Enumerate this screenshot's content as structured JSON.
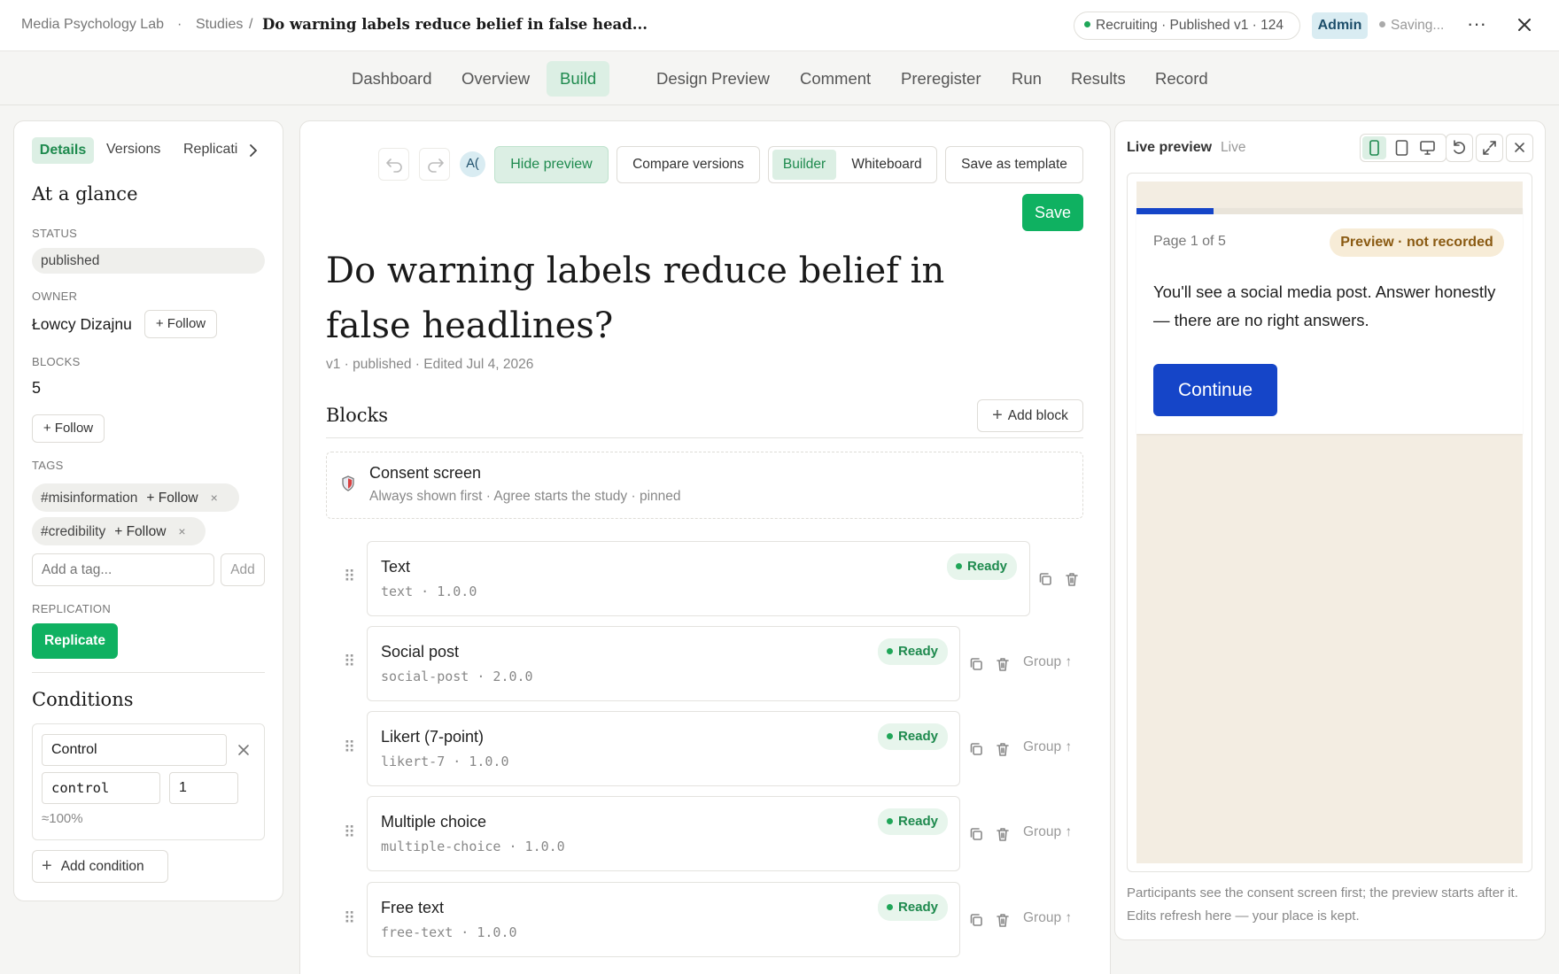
{
  "breadcrumb": {
    "org": "Media Psychology Lab",
    "sep1": "·",
    "studies": "Studies",
    "sep2": "/",
    "current": "Do warning labels reduce belief in false head..."
  },
  "header": {
    "status": "Recruiting · Published v1 · 124",
    "role": "Admin",
    "saving": "Saving...",
    "more_icon": "ellipsis-icon",
    "close_icon": "close-icon"
  },
  "nav_tabs": [
    "Dashboard",
    "Overview",
    "Build",
    "Design",
    "Preview",
    "Comment",
    "Preregister",
    "Run",
    "Results",
    "Record"
  ],
  "active_tab": "Build",
  "sidebar": {
    "tabs": [
      "Details",
      "Versions",
      "Replicati"
    ],
    "heading": "At a glance",
    "status_label": "STATUS",
    "status_value": "published",
    "owner_label": "OWNER",
    "owner_name": "Łowcy Dizajnu",
    "follow": "+ Follow",
    "blocks_label": "BLOCKS",
    "blocks_value": "5",
    "tags_label": "TAGS",
    "tags": [
      {
        "name": "#misinformation",
        "follow": "+ Follow"
      },
      {
        "name": "#credibility",
        "follow": "+ Follow"
      }
    ],
    "tag_remove": "×",
    "tag_placeholder": "Add a tag...",
    "add_label": "Add",
    "replication_label": "REPLICATION",
    "replicate_button": "Replicate",
    "conditions_heading": "Conditions",
    "condition": {
      "name": "Control",
      "key": "control",
      "weight": "1",
      "share": "≈100%"
    },
    "add_condition": "Add condition"
  },
  "toolbar": {
    "avatar": "A(",
    "hide_preview": "Hide preview",
    "compare": "Compare versions",
    "builder": "Builder",
    "whiteboard": "Whiteboard",
    "save_template": "Save as template",
    "save": "Save"
  },
  "main": {
    "title": "Do warning labels reduce belief in false headlines?",
    "meta": "v1 · published · Edited Jul 4, 2026",
    "blocks_heading": "Blocks",
    "add_block": "Add block",
    "consent": {
      "title": "Consent screen",
      "subtitle": "Always shown first · Agree starts the study · pinned"
    },
    "blocks": [
      {
        "title": "Text",
        "sub": "text · 1.0.0",
        "status": "Ready"
      },
      {
        "title": "Social post",
        "sub": "social-post · 2.0.0",
        "status": "Ready",
        "group": "Group ↑"
      },
      {
        "title": "Likert (7-point)",
        "sub": "likert-7 · 1.0.0",
        "status": "Ready",
        "group": "Group ↑"
      },
      {
        "title": "Multiple choice",
        "sub": "multiple-choice · 1.0.0",
        "status": "Ready",
        "group": "Group ↑"
      },
      {
        "title": "Free text",
        "sub": "free-text · 1.0.0",
        "status": "Ready",
        "group": "Group ↑"
      }
    ]
  },
  "preview": {
    "title": "Live preview",
    "live": "Live",
    "page": "Page 1 of 5",
    "badge": "Preview · not recorded",
    "progress": 0.2,
    "body": "You'll see a social media post. Answer honestly — there are no right answers.",
    "continue": "Continue",
    "note": "Participants see the consent screen first; the preview starts after it. Edits refresh here — your place is kept."
  },
  "colors": {
    "accent_green": "#0fb161",
    "primary_blue": "#1545c8",
    "preview_bg": "#f3ede2"
  }
}
